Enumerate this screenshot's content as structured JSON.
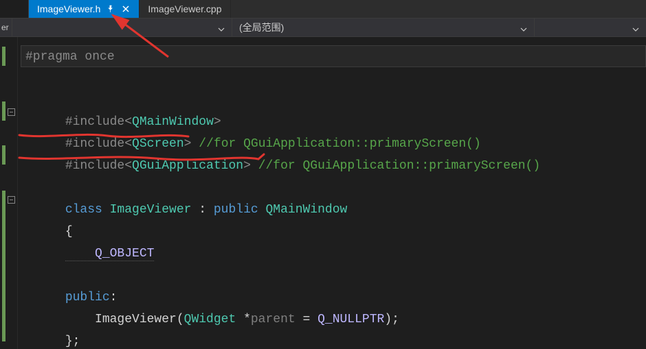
{
  "tabs": {
    "active": {
      "label": "ImageViewer.h"
    },
    "inactive": {
      "label": "ImageViewer.cpp"
    }
  },
  "scope": {
    "left_fragment": "er",
    "right": "(全局范围)"
  },
  "code": {
    "l1": "#pragma once",
    "l3a": "#include",
    "l3b": "<",
    "l3c": "QMainWindow",
    "l3d": ">",
    "l4a": "#include",
    "l4b": "<",
    "l4c": "QScreen",
    "l4d": ">",
    "l4e": " //for QGuiApplication::primaryScreen()",
    "l5a": "#include",
    "l5b": "<",
    "l5c": "QGuiApplication",
    "l5d": ">",
    "l5e": " //for QGuiApplication::primaryScreen()",
    "l7a": "class ",
    "l7b": "ImageViewer",
    "l7c": " : ",
    "l7d": "public",
    "l7e": " ",
    "l7f": "QMainWindow",
    "l8": "{",
    "l9": "    Q_OBJECT",
    "l11a": "public",
    "l11b": ":",
    "l12a": "    ImageViewer(",
    "l12b": "QWidget",
    "l12c": " *",
    "l12d": "parent",
    "l12e": " = ",
    "l12f": "Q_NULLPTR",
    "l12g": ");",
    "l13": "};"
  }
}
